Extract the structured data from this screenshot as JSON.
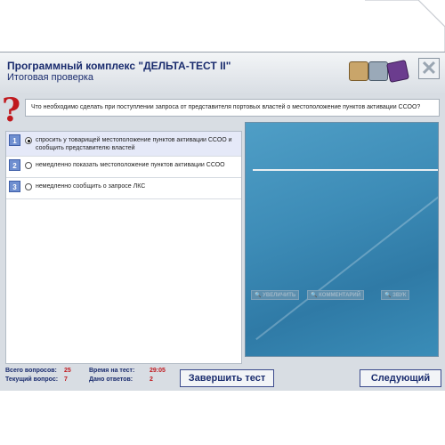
{
  "app": {
    "title": "Программный комплекс \"ДЕЛЬТА-ТЕСТ II\"",
    "subtitle": "Итоговая проверка"
  },
  "toolbar": {
    "icons": [
      "printer-icon",
      "calculator-icon",
      "book-icon",
      "close-icon"
    ],
    "close_glyph": "✕"
  },
  "question": {
    "mark": "?",
    "text": "Что необходимо сделать при поступлении запроса от представителя портовых властей о местоположение пунктов активации ССОО?"
  },
  "answers": [
    {
      "num": "1",
      "text": "спросить у товарищей местоположение пунктов активации ССОО и сообщить представителю властей",
      "selected": true
    },
    {
      "num": "2",
      "text": "немедленно показать местоположение пунктов активации ССОО",
      "selected": false
    },
    {
      "num": "3",
      "text": "немедленно сообщить о запросе ЛКС",
      "selected": false
    }
  ],
  "media": {
    "zoom_label": "🔍 УВЕЛИЧИТЬ",
    "comment_label": "🔍 КОММЕНТАРИЙ",
    "sound_label": "🔍 ЗВУК"
  },
  "footer": {
    "total_label": "Всего вопросов:",
    "total_value": "25",
    "current_label": "Текущий вопрос:",
    "current_value": "7",
    "time_label": "Время на тест:",
    "time_value": "29:05",
    "answered_label": "Дано ответов:",
    "answered_value": "2",
    "finish_label": "Завершить тест",
    "next_label": "Следующий"
  },
  "colors": {
    "accent": "#1a2c6e",
    "alert": "#c0191e",
    "selected_row": "#e5e9f8"
  }
}
